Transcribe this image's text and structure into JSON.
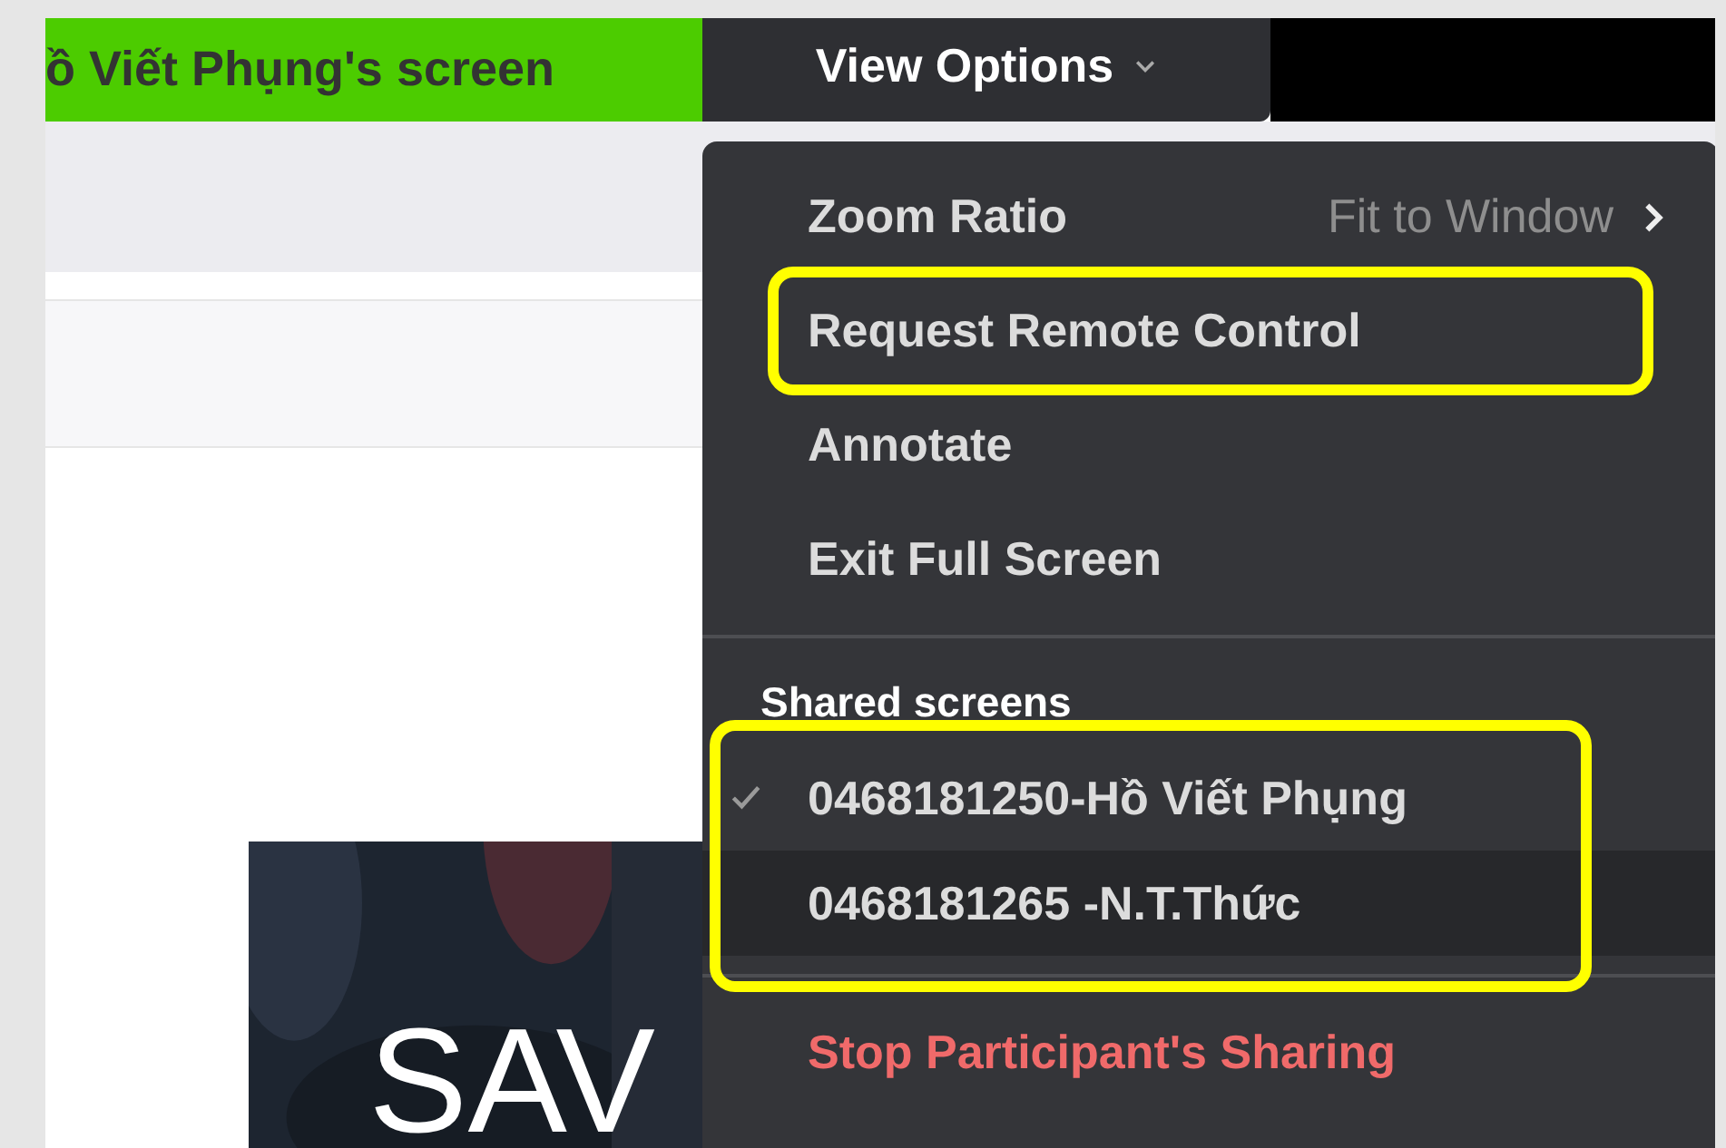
{
  "sharing_bar": {
    "title": "ồ Viết Phụng's screen",
    "view_options": "View Options"
  },
  "page": {
    "banner": {
      "kind": "picture",
      "text": "SAV"
    }
  },
  "menu": {
    "items": [
      {
        "label": "Zoom Ratio",
        "value": "Fit to Window",
        "submenu": true,
        "highlighted": false
      },
      {
        "label": "Request Remote Control",
        "highlighted": true
      },
      {
        "label": "Annotate",
        "highlighted": false
      },
      {
        "label": "Exit Full Screen",
        "highlighted": false
      }
    ],
    "shared_screens": {
      "heading": "Shared screens",
      "highlighted": true,
      "items": [
        {
          "label": "0468181250-Hồ Viết Phụng",
          "selected": true,
          "hovered": false
        },
        {
          "label": "0468181265 -N.T.Thức",
          "selected": false,
          "hovered": true
        }
      ]
    },
    "stop_action": "Stop Participant's Sharing"
  }
}
